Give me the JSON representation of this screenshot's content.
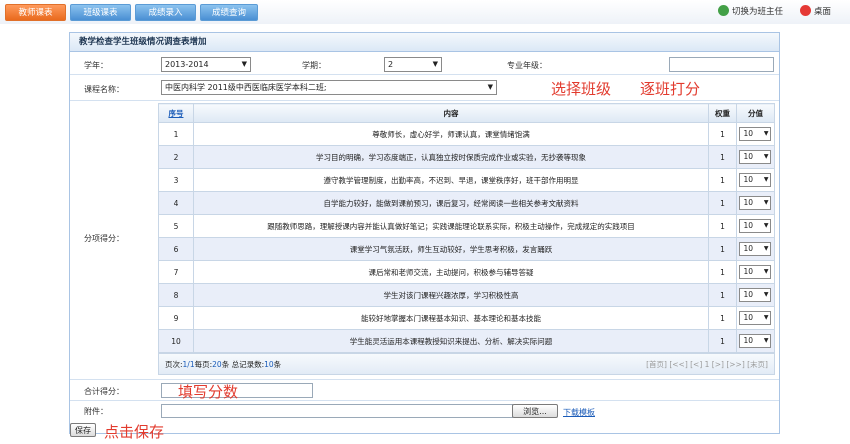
{
  "tabs": [
    {
      "label": "教师课表",
      "active": true
    },
    {
      "label": "班级课表",
      "active": false
    },
    {
      "label": "成绩录入",
      "active": false
    },
    {
      "label": "成绩查询",
      "active": false
    }
  ],
  "top_actions": {
    "switch_label": "切换为班主任",
    "switch_icon": "refresh-icon",
    "desktop_label": "桌面",
    "desktop_icon": "desktop-icon"
  },
  "panel": {
    "title": "教学检查学生班级情况调查表增加"
  },
  "form": {
    "year_label": "学年：",
    "year_value": "2013-2014",
    "term_label": "学期：",
    "term_value": "2",
    "grade_label": "专业年级：",
    "grade_value": "",
    "course_label": "课程名称：",
    "course_value": "中医内科学  2011级中西医临床医学本科二班;",
    "items_label": "分项得分：",
    "total_label": "合计得分：",
    "total_value": "",
    "attach_label": "附件：",
    "browse_label": "浏览...",
    "download_label": "下载模板",
    "save_label": "保存"
  },
  "table": {
    "headers": {
      "seq": "序号",
      "content": "内容",
      "weight": "权重",
      "score": "分值"
    },
    "rows": [
      {
        "seq": "1",
        "content": "尊敬师长，虚心好学，师课认真，课堂情绪饱满",
        "weight": "1",
        "score": "10"
      },
      {
        "seq": "2",
        "content": "学习目的明确，学习态度端正，认真独立按时保质完成作业或实验，无抄袭等现象",
        "weight": "1",
        "score": "10"
      },
      {
        "seq": "3",
        "content": "遵守教学管理制度，出勤率高，不迟到、早退，课堂秩序好，班干部作用明显",
        "weight": "1",
        "score": "10"
      },
      {
        "seq": "4",
        "content": "自学能力较好，能做到课前预习，课后复习，经常阅读一些相关参考文献资料",
        "weight": "1",
        "score": "10"
      },
      {
        "seq": "5",
        "content": "跟随教师思路，理解授课内容并能认真做好笔记；实践课能理论联系实际，积极主动操作，完成规定的实践项目",
        "weight": "1",
        "score": "10"
      },
      {
        "seq": "6",
        "content": "课堂学习气氛活跃，师生互动较好，学生思考积极，发言踊跃",
        "weight": "1",
        "score": "10"
      },
      {
        "seq": "7",
        "content": "课后常和老师交流，主动提问，积极参与辅导答疑",
        "weight": "1",
        "score": "10"
      },
      {
        "seq": "8",
        "content": "学生对该门课程兴趣浓厚，学习积极性高",
        "weight": "1",
        "score": "10"
      },
      {
        "seq": "9",
        "content": "能较好地掌握本门课程基本知识、基本理论和基本技能",
        "weight": "1",
        "score": "10"
      },
      {
        "seq": "10",
        "content": "学生能灵活运用本课程教授知识来提出、分析、解决实际问题",
        "weight": "1",
        "score": "10"
      }
    ]
  },
  "pager": {
    "page_label": "页次:",
    "page_value": "1/1",
    "per_page_label": "每页:",
    "per_page_value": "20",
    "per_page_unit": "条 总记录数:",
    "total_value": "10",
    "total_unit": "条",
    "nav": "[首页] [<<] [<] 1 [>] [>>] [末页]"
  },
  "annotations": {
    "select_class": "选择班级",
    "score_each": "逐班打分",
    "fill_score": "填写分数",
    "click_save": "点击保存"
  },
  "colors": {
    "annotation": "#e23b2e",
    "active_tab": "#e96a1e",
    "tab": "#4a8fd3",
    "link": "#1a5bb8"
  }
}
